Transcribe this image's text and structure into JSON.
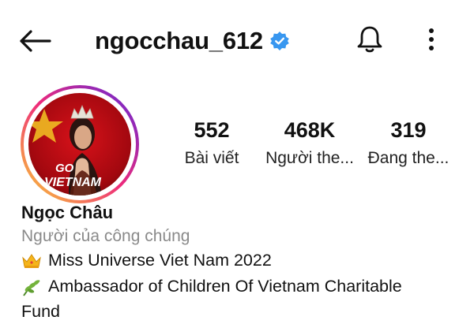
{
  "header": {
    "username": "ngocchau_612",
    "verified": true,
    "icons": [
      "back-arrow-icon",
      "verified-badge-icon",
      "bell-icon",
      "more-vertical-icon"
    ]
  },
  "profile": {
    "avatar_text": "GO FOR VIETNAM",
    "display_name": "Ngọc Châu",
    "category": "Người của công chúng"
  },
  "stats": [
    {
      "value": "552",
      "label": "Bài viết"
    },
    {
      "value": "468K",
      "label": "Người the..."
    },
    {
      "value": "319",
      "label": "Đang the..."
    }
  ],
  "bio": {
    "line1": "Miss Universe Viet Nam 2022",
    "line1_icon": "crown-icon",
    "line2": "Ambassador of Children Of Vietnam Charitable",
    "line2_icon": "herb-icon",
    "line3": "Fund"
  },
  "colors": {
    "verified_blue": "#3897f0",
    "ring_start": "#f9ce34",
    "ring_mid": "#ee2a7b",
    "ring_end": "#6228d7",
    "muted_text": "#8a8a8a"
  }
}
